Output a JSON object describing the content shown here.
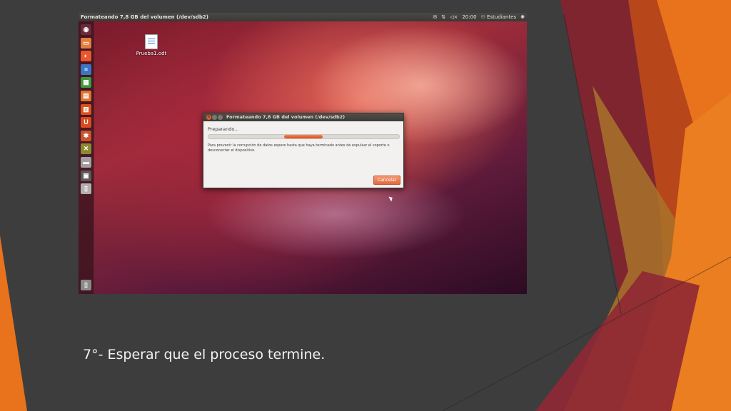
{
  "window": {
    "title": "Formateando 7,8 GB del volumen (/dev/sdb2)"
  },
  "tray": {
    "mail_icon": "envelope-icon",
    "network_icon": "network-arrows-icon",
    "volume_icon": "speaker-muted-icon",
    "time": "20:00",
    "user_icon": "person-icon",
    "user": "Estudiantes",
    "settings_icon": "gear-icon"
  },
  "launcher": {
    "items": [
      {
        "name": "dash-home-icon",
        "glyph": "◉",
        "color": "#6b2a3a"
      },
      {
        "name": "files-icon",
        "glyph": "▭",
        "color": "#e27d3c"
      },
      {
        "name": "firefox-icon",
        "glyph": "◐",
        "color": "#e8582c"
      },
      {
        "name": "writer-icon",
        "glyph": "≡",
        "color": "#3b75c4"
      },
      {
        "name": "calc-icon",
        "glyph": "▦",
        "color": "#3d9b3d"
      },
      {
        "name": "impress-icon",
        "glyph": "▤",
        "color": "#e0752e"
      },
      {
        "name": "software-center-icon",
        "glyph": "▥",
        "color": "#d9531e"
      },
      {
        "name": "ubuntu-one-icon",
        "glyph": "U",
        "color": "#d84b20"
      },
      {
        "name": "system-settings-icon",
        "glyph": "✱",
        "color": "#c8542e"
      },
      {
        "name": "tool-icon",
        "glyph": "✕",
        "color": "#8a8a30"
      },
      {
        "name": "disk-utility-icon",
        "glyph": "▬",
        "color": "#a0a0a0"
      },
      {
        "name": "terminal-icon",
        "glyph": "▣",
        "color": "#5a5a5a"
      },
      {
        "name": "usb-drive-icon",
        "glyph": "▯",
        "color": "#b0b0b0"
      }
    ],
    "trash_icon": "trash-icon"
  },
  "desktop": {
    "file_label": "Prueba1.odt"
  },
  "dialog": {
    "title": "Formateando 7,8 GB del volumen (/dev/sdb2)",
    "status": "Preparando...",
    "message": "Para prevenir la corrupción de datos espere hasta que haya terminado antes de expulsar el soporte o desconectar el dispositivo.",
    "cancel_label": "Cancelar",
    "progress_indicator": "indeterminate"
  },
  "slide": {
    "caption": "7°- Esperar que el proceso termine.",
    "colors": {
      "background": "#3d3d3d",
      "orange": "#e8731c",
      "dark_red": "#8b2530",
      "dark_orange": "#c55a1a"
    }
  }
}
